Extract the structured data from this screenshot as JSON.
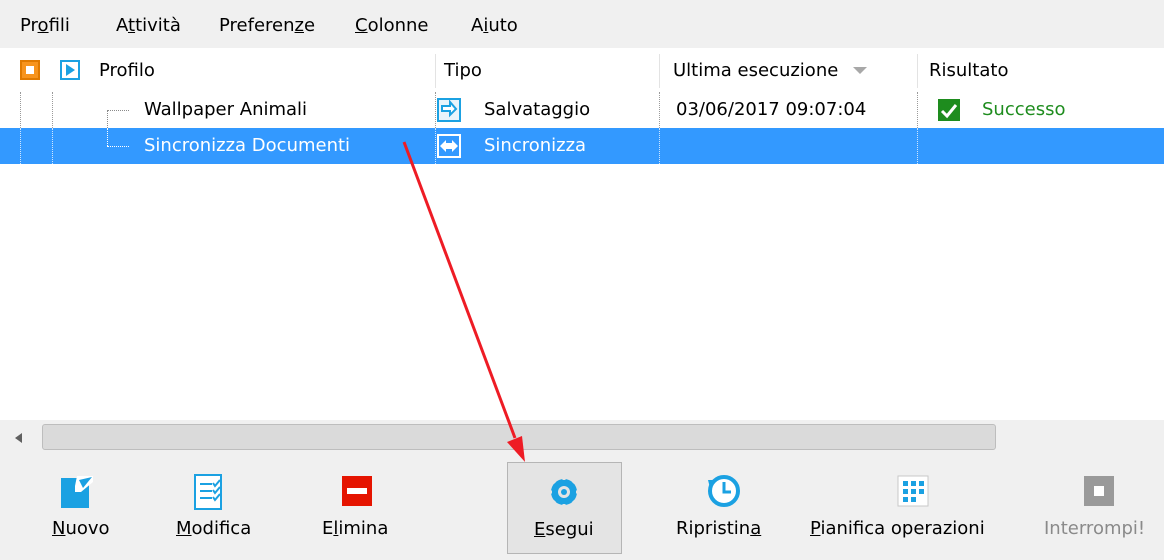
{
  "menu": {
    "items": [
      {
        "label": "Profili",
        "u": "o"
      },
      {
        "label": "Attività",
        "u": "t"
      },
      {
        "label": "Preferenze",
        "u": "z"
      },
      {
        "label": "Colonne",
        "u": "C"
      },
      {
        "label": "Aiuto",
        "u": "i"
      }
    ]
  },
  "columns": {
    "profilo": "Profilo",
    "tipo": "Tipo",
    "ultima": "Ultima esecuzione",
    "risultato": "Risultato"
  },
  "rows": [
    {
      "name": "Wallpaper Animali",
      "type": "Salvataggio",
      "last_run": "03/06/2017 09:07:04",
      "result": "Successo",
      "selected": false
    },
    {
      "name": "Sincronizza Documenti",
      "type": "Sincronizza",
      "last_run": "",
      "result": "",
      "selected": true
    }
  ],
  "toolbar": {
    "nuovo": "Nuovo",
    "modifica": "Modifica",
    "elimina": "Elimina",
    "esegui": "Esegui",
    "ripristina": "Ripristina",
    "pianifica": "Pianifica operazioni",
    "interrompi": "Interrompi!"
  },
  "colors": {
    "selection": "#3399ff",
    "success": "#1e8c1e",
    "accent_blue": "#1ba1e2",
    "delete_red": "#e51400",
    "annotation_arrow": "#ee1c25"
  },
  "icons": {
    "header_stop": "orange-square-icon",
    "header_play": "blue-play-icon",
    "backup": "backup-arrows-icon",
    "sync": "sync-arrows-icon",
    "success": "green-check-icon",
    "new": "new-profile-icon",
    "edit": "edit-list-icon",
    "delete": "delete-icon",
    "run": "gear-icon",
    "restore": "restore-clock-icon",
    "schedule": "grid-calendar-icon",
    "stop": "stop-square-icon"
  }
}
